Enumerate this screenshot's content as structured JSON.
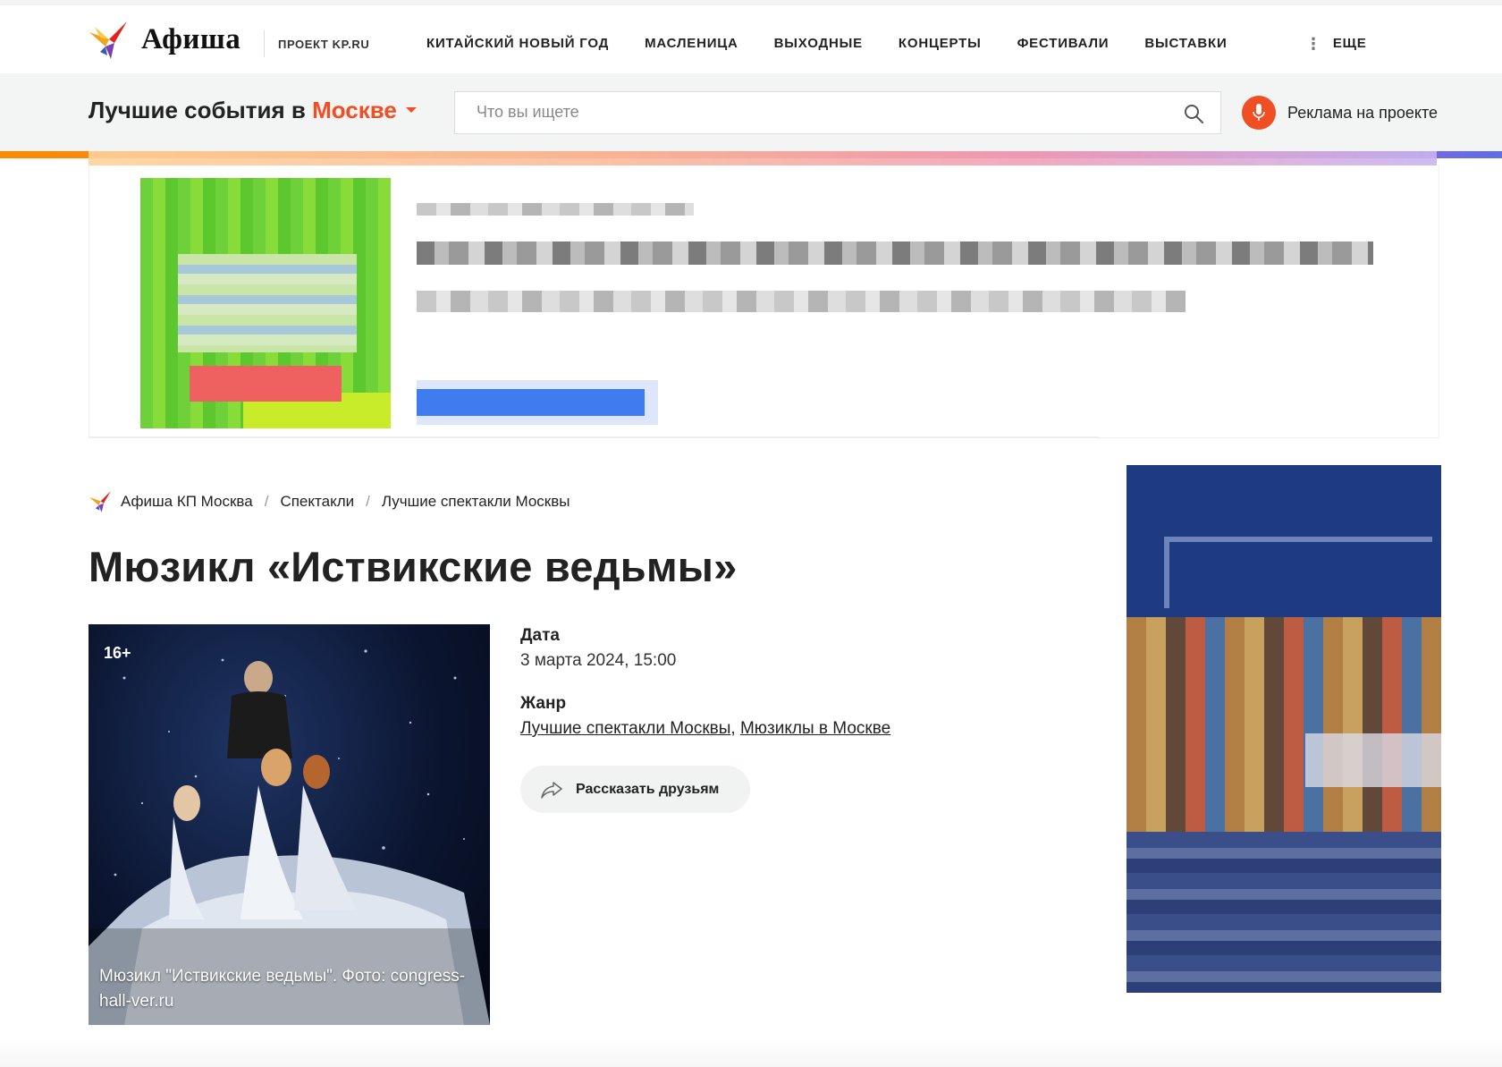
{
  "header": {
    "logo_text": "Афиша",
    "project_label": "ПРОЕКТ KP.RU",
    "nav": [
      {
        "label": "КИТАЙСКИЙ НОВЫЙ ГОД"
      },
      {
        "label": "МАСЛЕНИЦА"
      },
      {
        "label": "ВЫХОДНЫЕ"
      },
      {
        "label": "КОНЦЕРТЫ"
      },
      {
        "label": "ФЕСТИВАЛИ"
      },
      {
        "label": "ВЫСТАВКИ"
      }
    ],
    "more_label": "ЕЩЕ"
  },
  "band": {
    "title_prefix": "Лучшие события в",
    "city": "Москве",
    "search_placeholder": "Что вы ищете",
    "ad_link": "Реклама на проекте"
  },
  "breadcrumb": [
    {
      "label": "Афиша КП Москва"
    },
    {
      "label": "Спектакли"
    },
    {
      "label": "Лучшие спектакли Москвы"
    }
  ],
  "event": {
    "title": "Мюзикл «Иствикские ведьмы»",
    "age_rating": "16+",
    "photo_caption": "Мюзикл \"Иствикские ведьмы\". Фото: congress-hall-ver.ru",
    "date_label": "Дата",
    "date_value": "3 марта 2024, 15:00",
    "genre_label": "Жанр",
    "genres": [
      "Лучшие спектакли Москвы",
      "Мюзиклы в Москве"
    ],
    "share_label": "Рассказать друзьям"
  },
  "colors": {
    "accent": "#f04e23",
    "band_bg": "#f3f4f4",
    "share_bg": "#f1f2f2"
  },
  "icons": {
    "logo": "firebird-logo-icon",
    "search": "search-icon",
    "mic": "microphone-icon",
    "share": "share-arrow-icon",
    "more": "vertical-dots-icon",
    "caret": "caret-down-icon"
  }
}
